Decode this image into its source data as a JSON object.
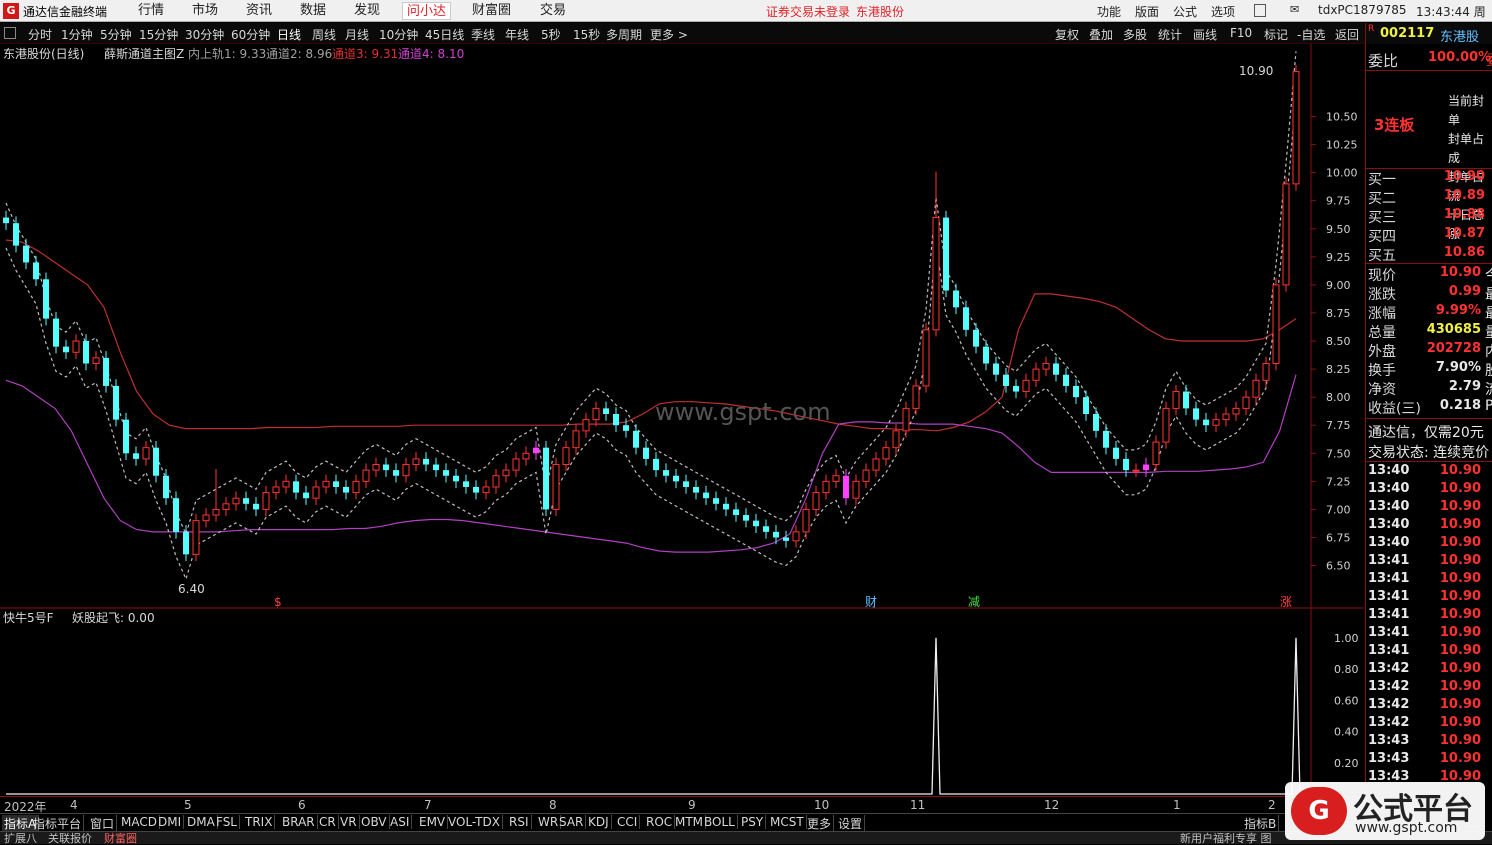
{
  "app": {
    "title": "通达信金融终端",
    "logo": "G"
  },
  "menu": [
    "行情",
    "市场",
    "资讯",
    "数据",
    "发现",
    "问小达",
    "财富圈",
    "交易"
  ],
  "menu_active_index": 5,
  "notice_login": "证券交易未登录",
  "notice_stock": "东港股份",
  "menu_right": [
    "功能",
    "版面",
    "公式",
    "选项"
  ],
  "user": "tdxPC1879785",
  "clock": "13:43:44 周二",
  "periods": [
    "分时",
    "1分钟",
    "5分钟",
    "15分钟",
    "30分钟",
    "60分钟",
    "日线",
    "周线",
    "月线",
    "10分钟",
    "45日线",
    "季线",
    "年线",
    "5秒",
    "15秒",
    "多周期",
    "更多 >"
  ],
  "period_selected_index": 6,
  "tools": [
    "复权",
    "叠加",
    "多股",
    "统计",
    "画线",
    "F10",
    "标记",
    "-自选",
    "返回"
  ],
  "main_chart": {
    "stock_label": "东港股份(日线)",
    "indicator": "薛斯通道主图Z",
    "lines": [
      {
        "text": "内上轨1: 9.33",
        "color": "#a0a0a0"
      },
      {
        "text": "通道2: 8.96",
        "color": "#a0a0a0"
      },
      {
        "text": "通道3: 9.31",
        "color": "#e03030"
      },
      {
        "text": "通道4: 8.10",
        "color": "#cc44cc"
      }
    ],
    "watermark": "www.gspt.com",
    "max_label": "10.90",
    "min_label": "6.40",
    "markers": [
      {
        "text": "$",
        "color": "#ff4040"
      },
      {
        "text": "财",
        "color": "#60c0ff"
      },
      {
        "text": "减",
        "color": "#40e040"
      },
      {
        "text": "涨",
        "color": "#ff4040"
      }
    ]
  },
  "sub_chart": {
    "indicator": "快牛5号F",
    "line_label": "妖股起飞: 0.00",
    "y_ticks": [
      "1.00",
      "0.80",
      "0.60",
      "0.40",
      "0.20"
    ]
  },
  "chart_data": [
    {
      "type": "candlestick",
      "title": "东港股份(日线)",
      "ylim": [
        6.3,
        10.95
      ],
      "y_ticks": [
        10.5,
        10.25,
        10.0,
        9.75,
        9.5,
        9.25,
        9.0,
        8.75,
        8.5,
        8.25,
        8.0,
        7.75,
        7.5,
        7.25,
        7.0,
        6.75,
        6.5
      ],
      "x_tick_labels": [
        "2022年",
        "4",
        "5",
        "6",
        "7",
        "8",
        "9",
        "10",
        "11",
        "12",
        "1",
        "2"
      ],
      "close": [
        9.55,
        9.35,
        9.2,
        9.05,
        8.7,
        8.45,
        8.4,
        8.5,
        8.3,
        8.35,
        8.1,
        7.8,
        7.5,
        7.45,
        7.55,
        7.3,
        7.1,
        6.8,
        6.6,
        6.9,
        6.95,
        7.0,
        7.05,
        7.1,
        7.05,
        7.0,
        7.15,
        7.2,
        7.25,
        7.15,
        7.1,
        7.2,
        7.25,
        7.2,
        7.15,
        7.25,
        7.35,
        7.4,
        7.35,
        7.3,
        7.4,
        7.45,
        7.4,
        7.35,
        7.3,
        7.25,
        7.2,
        7.15,
        7.2,
        7.3,
        7.35,
        7.45,
        7.5,
        7.55,
        7.0,
        7.4,
        7.55,
        7.7,
        7.8,
        7.9,
        7.85,
        7.75,
        7.7,
        7.55,
        7.45,
        7.35,
        7.3,
        7.25,
        7.2,
        7.15,
        7.1,
        7.05,
        7.0,
        6.95,
        6.9,
        6.85,
        6.8,
        6.75,
        6.72,
        6.8,
        7.0,
        7.15,
        7.25,
        7.3,
        7.1,
        7.25,
        7.35,
        7.45,
        7.55,
        7.7,
        7.9,
        8.1,
        8.6,
        9.6,
        8.95,
        8.8,
        8.6,
        8.45,
        8.3,
        8.2,
        8.1,
        8.05,
        8.15,
        8.25,
        8.3,
        8.2,
        8.1,
        8.0,
        7.85,
        7.7,
        7.55,
        7.45,
        7.35,
        7.35,
        7.4,
        7.6,
        7.9,
        8.05,
        7.9,
        7.8,
        7.75,
        7.8,
        7.85,
        7.9,
        8.0,
        8.15,
        8.3,
        9.0,
        9.9,
        10.9
      ],
      "upper_band": [
        9.4,
        9.38,
        9.3,
        9.2,
        9.1,
        9.0,
        8.8,
        8.4,
        8.05,
        7.85,
        7.75,
        7.72,
        7.72,
        7.72,
        7.72,
        7.72,
        7.73,
        7.73,
        7.73,
        7.73,
        7.74,
        7.74,
        7.74,
        7.74,
        7.74,
        7.75,
        7.75,
        7.75,
        7.75,
        7.75,
        7.75,
        7.75,
        7.75,
        7.75,
        7.75,
        7.76,
        7.76,
        7.76,
        7.78,
        7.85,
        7.94,
        7.96,
        7.96,
        7.95,
        7.94,
        7.92,
        7.9,
        7.88,
        7.85,
        7.82,
        7.79,
        7.76,
        7.74,
        7.72,
        7.72,
        7.71,
        7.71,
        7.7,
        7.73,
        7.78,
        7.87,
        8.0,
        8.6,
        8.92,
        8.92,
        8.9,
        8.88,
        8.85,
        8.8,
        8.7,
        8.6,
        8.52,
        8.5,
        8.5,
        8.5,
        8.5,
        8.5,
        8.52,
        8.6,
        8.7
      ],
      "lower_band": [
        8.15,
        8.1,
        8.0,
        7.9,
        7.7,
        7.4,
        7.1,
        6.9,
        6.82,
        6.8,
        6.8,
        6.8,
        6.8,
        6.8,
        6.81,
        6.82,
        6.82,
        6.82,
        6.82,
        6.82,
        6.82,
        6.83,
        6.83,
        6.85,
        6.88,
        6.9,
        6.91,
        6.91,
        6.9,
        6.88,
        6.86,
        6.84,
        6.82,
        6.8,
        6.78,
        6.76,
        6.74,
        6.72,
        6.7,
        6.66,
        6.63,
        6.62,
        6.62,
        6.62,
        6.63,
        6.64,
        6.66,
        6.7,
        6.78,
        7.1,
        7.5,
        7.76,
        7.78,
        7.78,
        7.77,
        7.77,
        7.76,
        7.76,
        7.76,
        7.74,
        7.72,
        7.68,
        7.56,
        7.42,
        7.33,
        7.33,
        7.33,
        7.33,
        7.33,
        7.33,
        7.33,
        7.34,
        7.34,
        7.34,
        7.35,
        7.36,
        7.38,
        7.42,
        7.7,
        8.2
      ]
    },
    {
      "type": "line",
      "title": "快牛5号F",
      "series": [
        {
          "name": "妖股起飞",
          "spikes_at_index": [
            93,
            129
          ],
          "values_note_only": "0 except spikes of 1.00"
        }
      ],
      "ylim": [
        0,
        1.05
      ]
    }
  ],
  "x_axis_labels": [
    "2022年",
    "4",
    "5",
    "6",
    "7",
    "8",
    "9",
    "10",
    "11",
    "12",
    "1",
    "2"
  ],
  "indicator_tabs": [
    "指标A",
    "指标平台",
    "窗口",
    "MACD",
    "DMI",
    "DMA",
    "FSL",
    "TRIX",
    "BRAR",
    "CR",
    "VR",
    "OBV",
    "ASI",
    "EMV",
    "VOL-TDX",
    "RSI",
    "WR",
    "SAR",
    "KDJ",
    "CCI",
    "ROC",
    "MTM",
    "BOLL",
    "PSY",
    "MCST",
    "更多",
    "设置"
  ],
  "indicator_tab_selected": 0,
  "indicator_right_tab": "指标B",
  "status_left": [
    "扩展八",
    "关联报价",
    "财富圈"
  ],
  "status_right": "新用户福利专享 图",
  "right_panel": {
    "code": "002117",
    "name": "东港股",
    "weibi_label": "委比",
    "weibi_value": "100.00%",
    "weibi_suffix": "委",
    "streak": "3连板",
    "streak_notes": [
      "当前封单",
      "封单占成",
      "封单占流",
      "十日总涨"
    ],
    "bids": [
      {
        "label": "买一",
        "price": "10.90"
      },
      {
        "label": "买二",
        "price": "10.89"
      },
      {
        "label": "买三",
        "price": "10.88"
      },
      {
        "label": "买四",
        "price": "10.87"
      },
      {
        "label": "买五",
        "price": "10.86"
      }
    ],
    "quote": [
      {
        "label": "现价",
        "value": "10.90",
        "suffix": "今",
        "color": "#ff3232"
      },
      {
        "label": "涨跌",
        "value": "0.99",
        "suffix": "最",
        "color": "#ff3232"
      },
      {
        "label": "涨幅",
        "value": "9.99%",
        "suffix": "最",
        "color": "#ff3232"
      },
      {
        "label": "总量",
        "value": "430685",
        "suffix": "量",
        "color": "#f0f040"
      },
      {
        "label": "外盘",
        "value": "202728",
        "suffix": "内",
        "color": "#ff3232"
      },
      {
        "label": "换手",
        "value": "7.90%",
        "suffix": "股",
        "color": "#e8e8e8"
      },
      {
        "label": "净资",
        "value": "2.79",
        "suffix": "流",
        "color": "#e8e8e8"
      },
      {
        "label": "收益(三)",
        "value": "0.218",
        "suffix": "P",
        "color": "#e8e8e8"
      }
    ],
    "promo": "通达信，仅需20元",
    "trade_status": "交易状态: 连续竞价",
    "ticks": [
      {
        "time": "13:40",
        "price": "10.90"
      },
      {
        "time": "13:40",
        "price": "10.90"
      },
      {
        "time": "13:40",
        "price": "10.90"
      },
      {
        "time": "13:40",
        "price": "10.90"
      },
      {
        "time": "13:40",
        "price": "10.90"
      },
      {
        "time": "13:41",
        "price": "10.90"
      },
      {
        "time": "13:41",
        "price": "10.90"
      },
      {
        "time": "13:41",
        "price": "10.90"
      },
      {
        "time": "13:41",
        "price": "10.90"
      },
      {
        "time": "13:41",
        "price": "10.90"
      },
      {
        "time": "13:41",
        "price": "10.90"
      },
      {
        "time": "13:42",
        "price": "10.90"
      },
      {
        "time": "13:42",
        "price": "10.90"
      },
      {
        "time": "13:42",
        "price": "10.90"
      },
      {
        "time": "13:42",
        "price": "10.90"
      },
      {
        "time": "13:43",
        "price": "10.90"
      },
      {
        "time": "13:43",
        "price": "10.90"
      },
      {
        "time": "13:43",
        "price": "10.90"
      }
    ]
  },
  "brand_logo": {
    "mark": "G",
    "title": "公式平台",
    "url": "www.gspt.com"
  },
  "colors": {
    "up": "#ff3232",
    "down": "#54ffff",
    "limit_up": "#ff40ff",
    "band_upper": "#c03030",
    "band_lower": "#b040c0"
  }
}
